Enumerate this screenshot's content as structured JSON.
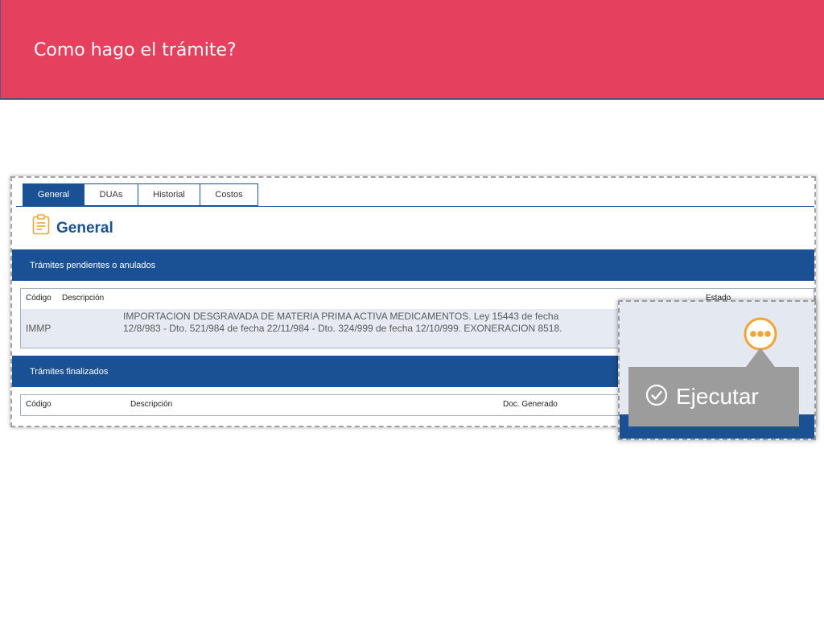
{
  "slide": {
    "title": "Como hago el trámite?"
  },
  "colors": {
    "header_red": "#E5405E",
    "brand_blue": "#1A5195",
    "row_bg": "#E6EBF3",
    "accent_orange": "#F2A533",
    "tooltip_grey": "#9C9C9C"
  },
  "tabs": [
    {
      "label": "General",
      "active": true
    },
    {
      "label": "DUAs",
      "active": false
    },
    {
      "label": "Historial",
      "active": false
    },
    {
      "label": "Costos",
      "active": false
    }
  ],
  "section": {
    "title": "General",
    "icon": "clipboard-icon"
  },
  "pending": {
    "title": "Trámites pendientes o anulados",
    "columns": [
      "Código",
      "Descripción",
      "Estado"
    ],
    "rows": [
      {
        "code": "IMMP",
        "description": "IMPORTACION DESGRAVADA DE MATERIA PRIMA ACTIVA MEDICAMENTOS. Ley 15443 de fecha 12/8/983 - Dto. 521/984 de fecha 22/11/984 - Dto. 324/999 de fecha 12/10/999. EXONERACION 8518."
      }
    ]
  },
  "finished": {
    "title": "Trámites finalizados",
    "columns": [
      "Código",
      "Descripción",
      "Doc. Generado"
    ]
  },
  "callout": {
    "action_icon": "more-options-icon",
    "tooltip": {
      "icon": "check-circle-icon",
      "label": "Ejecutar"
    }
  }
}
